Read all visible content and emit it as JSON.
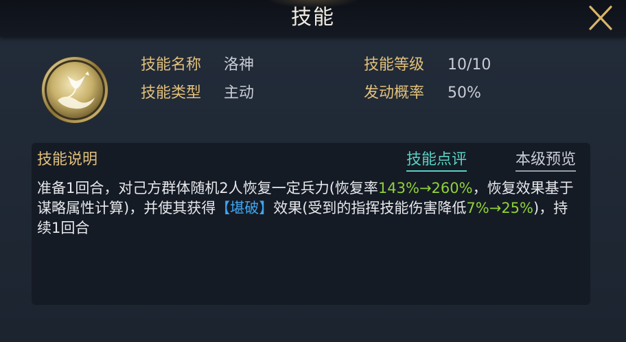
{
  "window": {
    "title": "技能",
    "close_icon": "close-x-icon"
  },
  "skill": {
    "icon": "goddess-skill-icon",
    "name_label": "技能名称",
    "name_value": "洛神",
    "type_label": "技能类型",
    "type_value": "主动",
    "level_label": "技能等级",
    "level_value": "10/10",
    "chance_label": "发动概率",
    "chance_value": "50%"
  },
  "description": {
    "title": "技能说明",
    "review_tab": "技能点评",
    "preview_tab": "本级预览",
    "part1": "准备1回合，对己方群体随机2人恢复一定兵力(恢复率",
    "rate1": "143%→260%",
    "part2": "，恢复效果基于谋略属性计算)，并使其获得",
    "status": "【堪破】",
    "part3": "效果(受到的指挥技能伤害降低",
    "rate2": "7%→25%",
    "part4": ")，持续1回合"
  },
  "colors": {
    "label_gold": "#e2c07a",
    "value_gray": "#c9cdd6",
    "highlight_green": "#8fd23a",
    "highlight_blue": "#3fa6f0",
    "tab_active_teal": "#5ad1c4"
  }
}
